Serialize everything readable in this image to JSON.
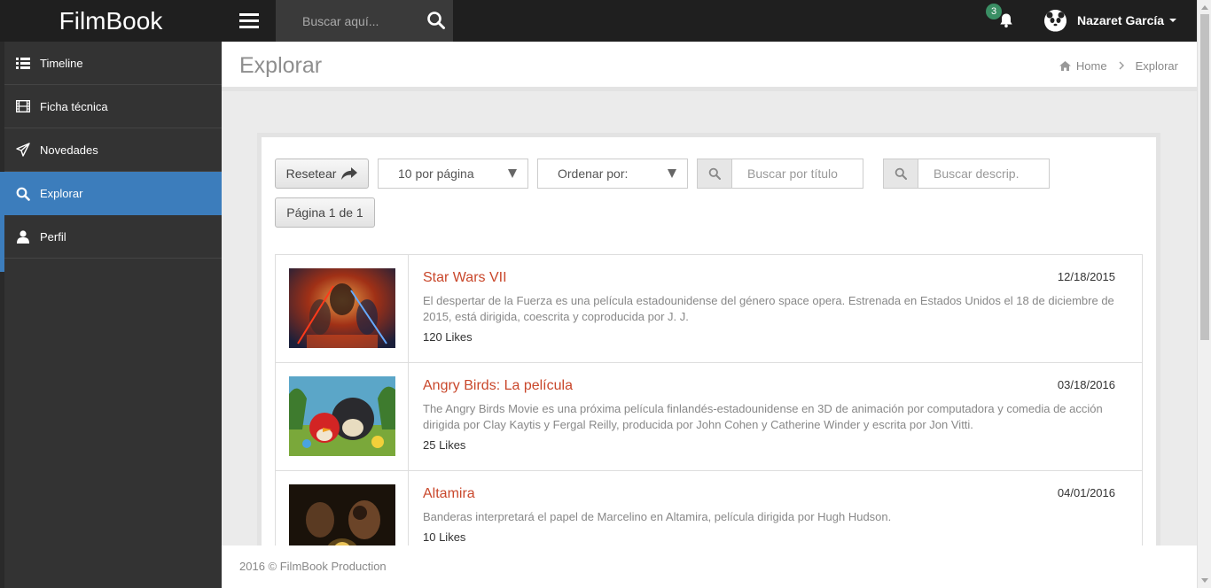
{
  "app": {
    "brand": "FilmBook"
  },
  "topbar": {
    "search_placeholder": "Buscar aquí...",
    "notifications_count": "3",
    "user_name": "Nazaret García"
  },
  "sidebar": {
    "items": [
      {
        "label": "Timeline",
        "icon": "list-icon"
      },
      {
        "label": "Ficha técnica",
        "icon": "film-icon"
      },
      {
        "label": "Novedades",
        "icon": "paper-plane-icon"
      },
      {
        "label": "Explorar",
        "icon": "search-icon",
        "active": true
      },
      {
        "label": "Perfil",
        "icon": "user-icon"
      }
    ]
  },
  "page": {
    "title": "Explorar",
    "breadcrumb": {
      "home": "Home",
      "current": "Explorar"
    }
  },
  "filters": {
    "reset_label": "Resetear",
    "per_page": "10 por página",
    "order_by": "Ordenar por:",
    "title_placeholder": "Buscar por título",
    "desc_placeholder": "Buscar descrip.",
    "pagination": "Página 1 de 1"
  },
  "movies": [
    {
      "title": "Star Wars VII",
      "date": "12/18/2015",
      "description": "El despertar de la Fuerza es una película estadounidense del género space opera. Estrenada en Estados Unidos el 18 de diciembre de 2015, está dirigida, coescrita y coproducida por J. J.",
      "likes": "120 Likes"
    },
    {
      "title": "Angry Birds: La película",
      "date": "03/18/2016",
      "description": "The Angry Birds Movie es una próxima película finlandés-estadounidense en 3D de animación por computadora y comedia de acción dirigida por Clay Kaytis y Fergal Reilly, producida por John Cohen y Catherine Winder y escrita por Jon Vitti.",
      "likes": "25 Likes"
    },
    {
      "title": "Altamira",
      "date": "04/01/2016",
      "description": "Banderas interpretará el papel de Marcelino en Altamira, película dirigida por Hugh Hudson.",
      "likes": "10 Likes"
    }
  ],
  "footer": {
    "text": "2016 © FilmBook Production"
  },
  "colors": {
    "accent": "#3c7dbc",
    "link": "#c9472b",
    "topbar": "#1f1f1f",
    "sidebar": "#333333",
    "badge": "#3a8e64"
  }
}
